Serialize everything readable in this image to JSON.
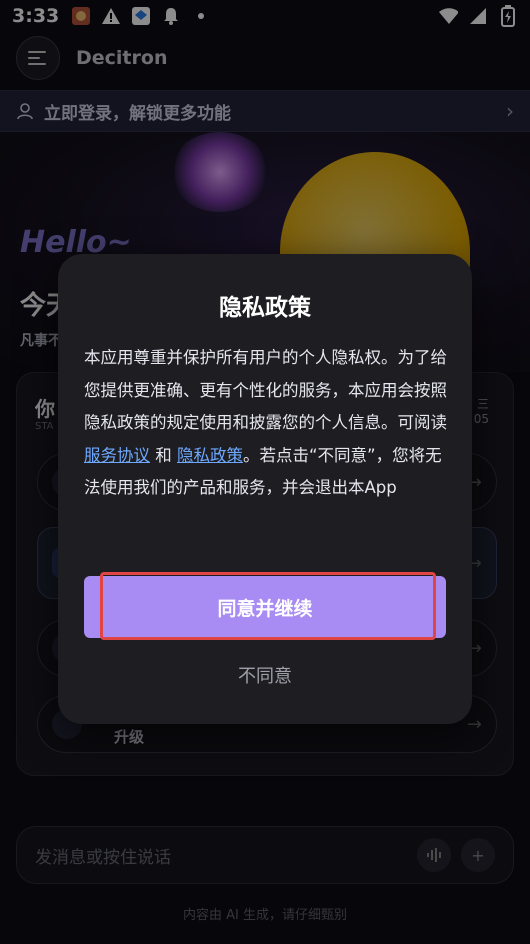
{
  "status_bar": {
    "time": "3:33",
    "icons_left": [
      "app-icon",
      "warning-icon",
      "dropbox-icon",
      "notification-bell-icon",
      "dot-icon"
    ],
    "icons_right": [
      "wifi-icon",
      "signal-icon",
      "battery-icon"
    ]
  },
  "header": {
    "app_title": "Decitron"
  },
  "login_banner": {
    "label": "立即登录，解锁更多功能"
  },
  "hero": {
    "hello": "Hello~",
    "today_partial": "今天",
    "sub_partial": "凡事不"
  },
  "panel": {
    "title_partial": "你",
    "sub_partial": "STA",
    "right_partial": "三",
    "right_sub_partial": "05",
    "upgrade_label": "升级"
  },
  "input": {
    "placeholder": "发消息或按住说话"
  },
  "disclaimer": "内容由 AI 生成，请仔细甄别",
  "modal": {
    "title": "隐私政策",
    "body_part1": "本应用尊重并保护所有用户的个人隐私权。为了给您提供更准确、更有个性化的服务，本应用会按照隐私政策的规定使用和披露您的个人信息。可阅读 ",
    "link_service": "服务协议",
    "and": " 和 ",
    "link_privacy": "隐私政策",
    "body_part2": "。若点击“不同意”，您将无法使用我们的产品和服务，并会退出本App",
    "agree_button": "同意并继续",
    "disagree_button": "不同意"
  },
  "colors": {
    "accent": "#a98cf3",
    "link": "#6ea9ff",
    "highlight": "#e04545"
  }
}
